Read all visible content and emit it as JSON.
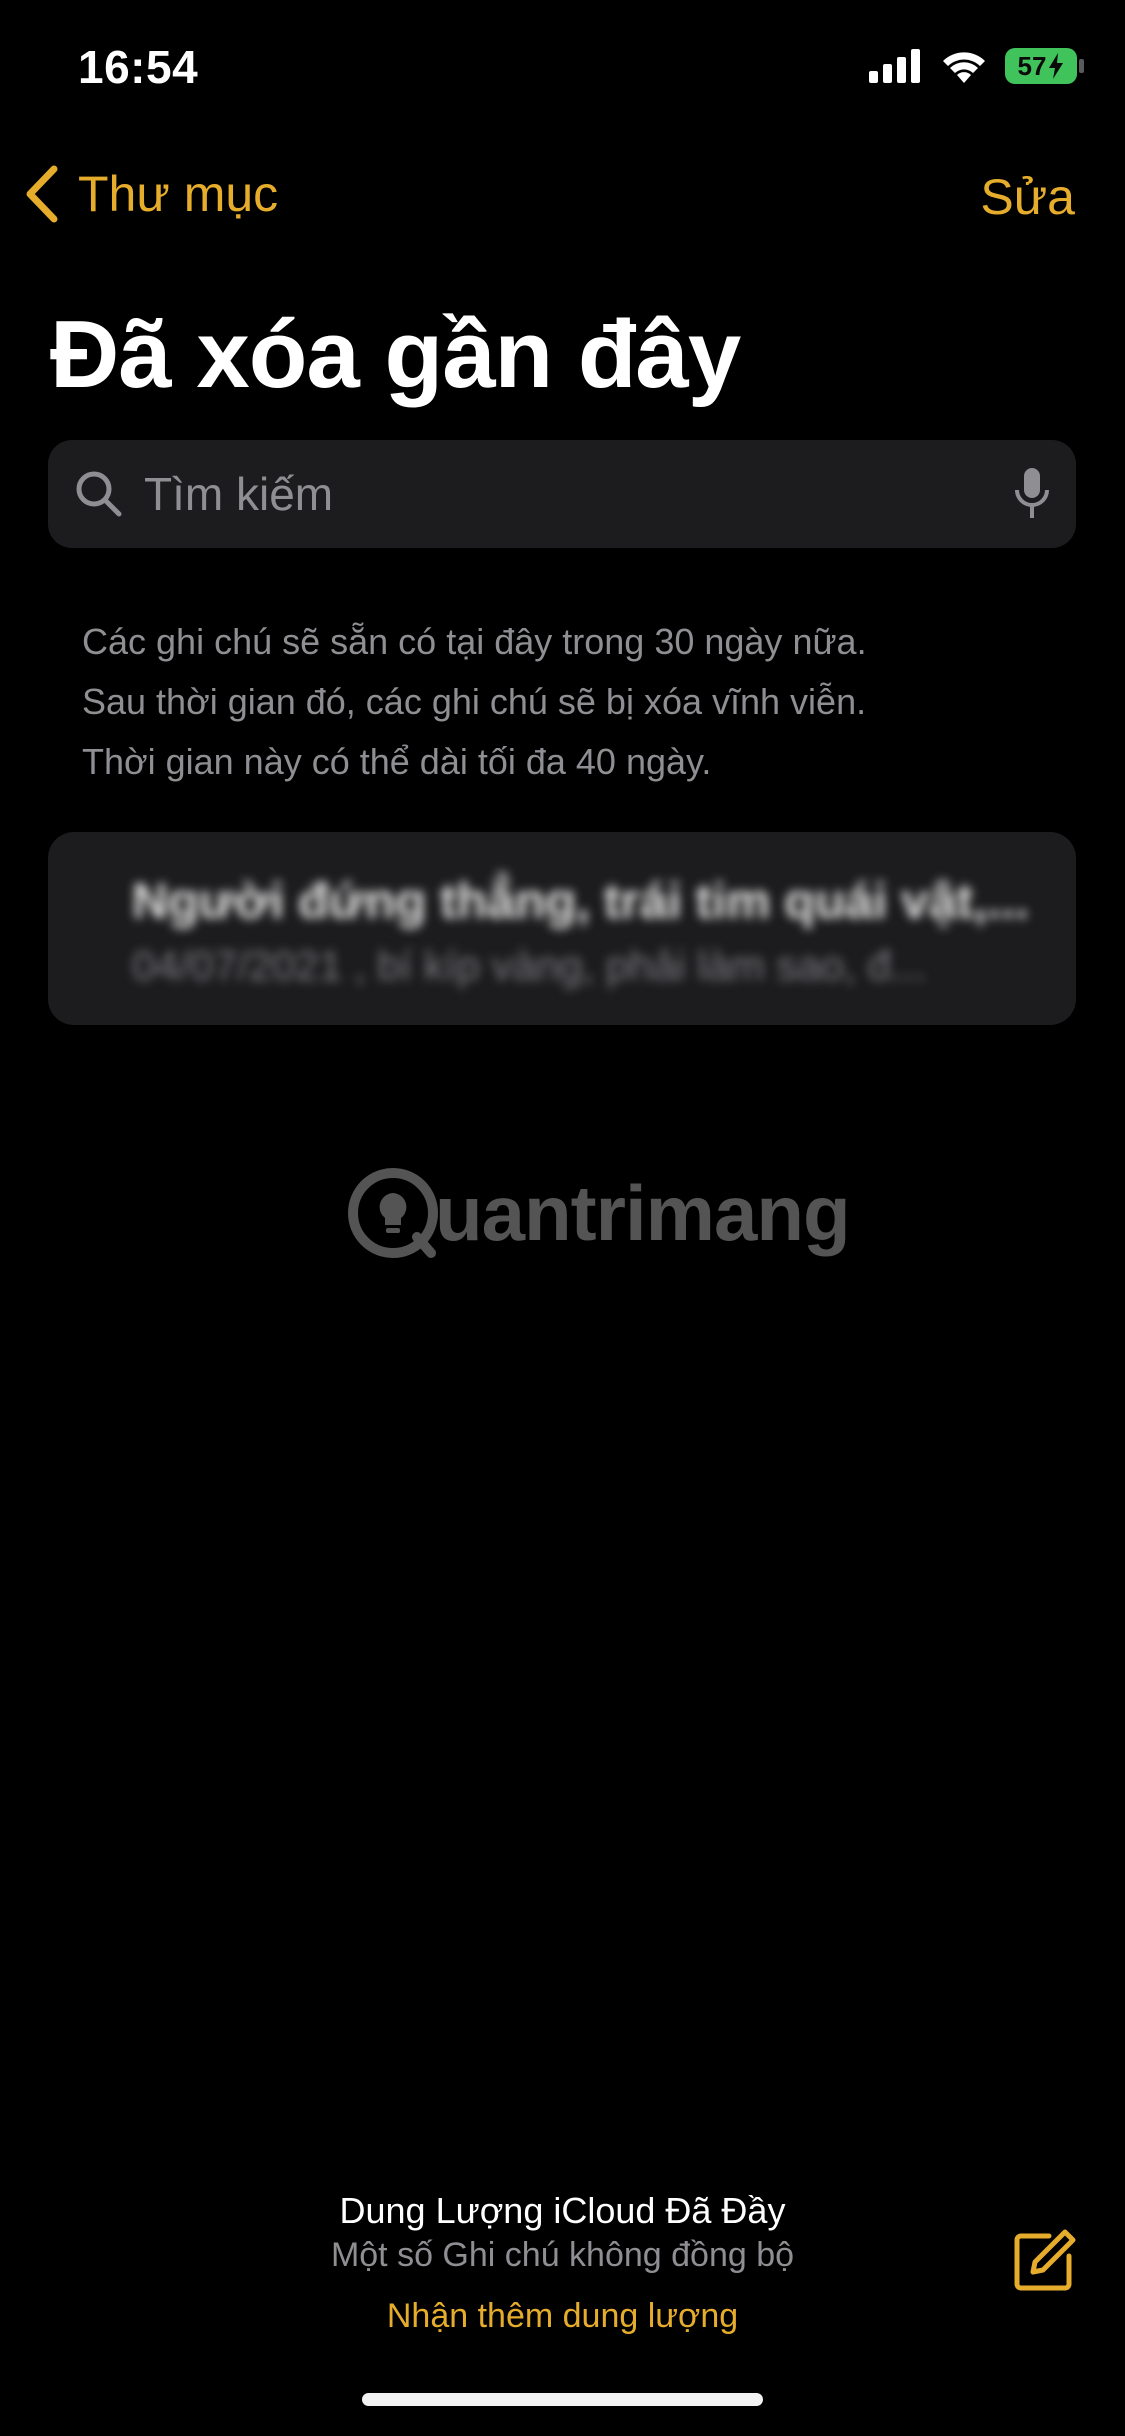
{
  "status_bar": {
    "time": "16:54",
    "battery": "57"
  },
  "nav": {
    "back_label": "Thư mục",
    "edit_label": "Sửa"
  },
  "page": {
    "title": "Đã xóa gần đây"
  },
  "search": {
    "placeholder": "Tìm kiếm"
  },
  "info": {
    "lines": [
      "Các ghi chú sẽ sẵn có tại đây trong 30 ngày nữa.",
      "Sau thời gian đó, các ghi chú sẽ bị xóa vĩnh viễn.",
      "Thời gian này có thể dài tối đa 40 ngày."
    ]
  },
  "notes": [
    {
      "title": "Người đứng thẳng, trái tim quái vật,...",
      "date": "04/07/2021",
      "preview": ", bí kíp vàng, phải làm sao, đ..."
    }
  ],
  "watermark": {
    "text": "uantrimang"
  },
  "footer": {
    "title": "Dung Lượng iCloud Đã Đầy",
    "subtitle": "Một số Ghi chú không đồng bộ",
    "link": "Nhận thêm dung lượng"
  },
  "colors": {
    "accent": "#e6ac2b",
    "background": "#000000",
    "card": "#1c1c1e",
    "secondary_text": "#8e8e93",
    "battery": "#3fc35a"
  }
}
